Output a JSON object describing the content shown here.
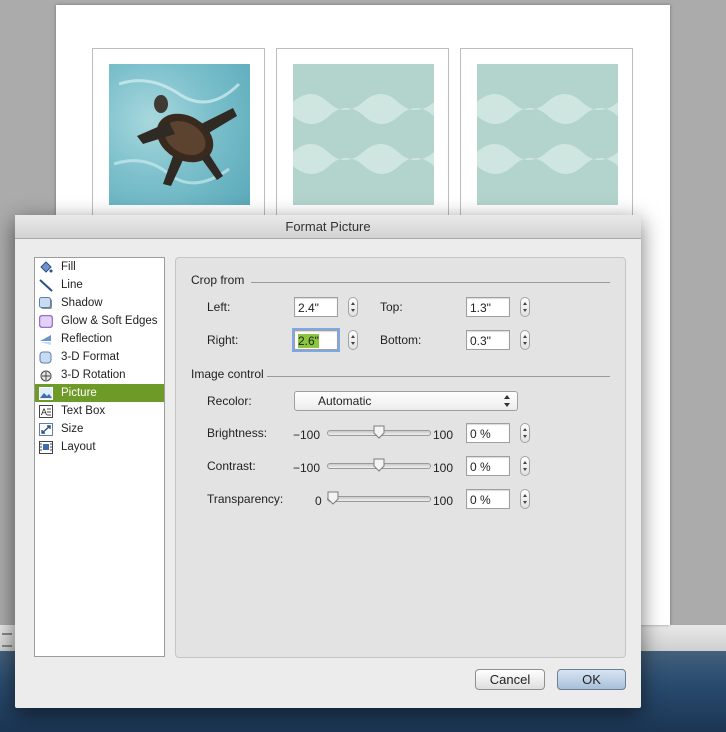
{
  "dialog": {
    "title": "Format Picture"
  },
  "sidebar": {
    "items": [
      {
        "label": "Fill",
        "icon": "paint-bucket-icon"
      },
      {
        "label": "Line",
        "icon": "line-icon"
      },
      {
        "label": "Shadow",
        "icon": "shadow-icon"
      },
      {
        "label": "Glow & Soft Edges",
        "icon": "glow-icon"
      },
      {
        "label": "Reflection",
        "icon": "reflection-icon"
      },
      {
        "label": "3-D Format",
        "icon": "3d-format-icon"
      },
      {
        "label": "3-D Rotation",
        "icon": "3d-rotation-icon"
      },
      {
        "label": "Picture",
        "icon": "picture-icon",
        "selected": true
      },
      {
        "label": "Text Box",
        "icon": "text-box-icon"
      },
      {
        "label": "Size",
        "icon": "size-icon"
      },
      {
        "label": "Layout",
        "icon": "layout-icon"
      }
    ]
  },
  "crop": {
    "title": "Crop from",
    "left_label": "Left:",
    "left_value": "2.4\"",
    "top_label": "Top:",
    "top_value": "1.3\"",
    "right_label": "Right:",
    "right_value": "2.6\"",
    "bottom_label": "Bottom:",
    "bottom_value": "0.3\""
  },
  "image_control": {
    "title": "Image control",
    "recolor_label": "Recolor:",
    "recolor_value": "Automatic",
    "brightness_label": "Brightness:",
    "brightness_min": "−100",
    "brightness_max": "100",
    "brightness_value": "0 %",
    "brightness_level": 0.5,
    "contrast_label": "Contrast:",
    "contrast_min": "−100",
    "contrast_max": "100",
    "contrast_value": "0 %",
    "contrast_level": 0.5,
    "transparency_label": "Transparency:",
    "transparency_min": "0",
    "transparency_max": "100",
    "transparency_value": "0 %",
    "transparency_level": 0.0
  },
  "buttons": {
    "cancel": "Cancel",
    "ok": "OK"
  },
  "colors": {
    "selection": "#6e9b27",
    "wave_bg": "#b2d4cd",
    "wave_light": "#cfe5e0"
  }
}
